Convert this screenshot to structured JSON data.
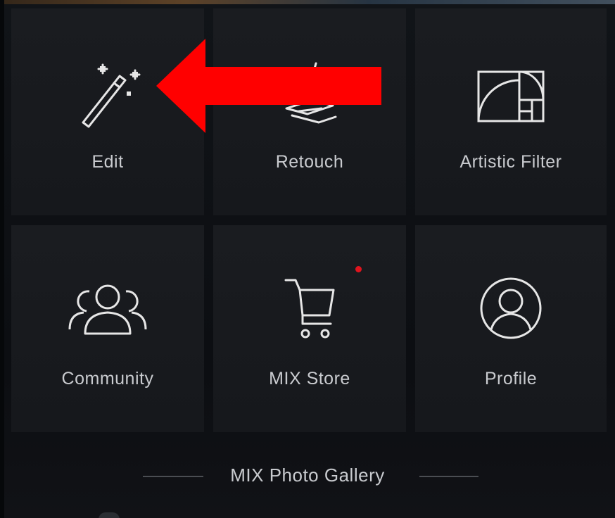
{
  "menu": {
    "tiles": [
      {
        "label": "Edit",
        "icon": "magic-wand-icon"
      },
      {
        "label": "Retouch",
        "icon": "retouch-icon"
      },
      {
        "label": "Artistic Filter",
        "icon": "golden-ratio-icon"
      },
      {
        "label": "Community",
        "icon": "people-icon"
      },
      {
        "label": "MIX Store",
        "icon": "cart-icon",
        "notification_dot": true
      },
      {
        "label": "Profile",
        "icon": "user-circle-icon"
      }
    ]
  },
  "footer": {
    "gallery_label": "MIX Photo Gallery"
  },
  "annotation": {
    "arrow_color": "#ff0000",
    "points_to": "Edit"
  },
  "colors": {
    "background": "#0d1014",
    "tile": "#1a1c20",
    "text": "#c9cbcf",
    "notification": "#e0141e"
  }
}
